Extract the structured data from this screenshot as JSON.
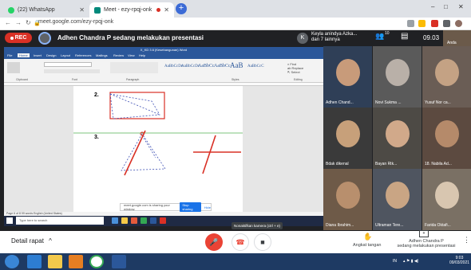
{
  "browser": {
    "tabs": [
      {
        "label": "(22) WhatsApp",
        "active": false
      },
      {
        "label": "Meet - ezy-rpqj-onk",
        "active": true
      }
    ],
    "url": "meet.google.com/ezy-rpqj-onk",
    "new_tab_symbol": "+",
    "controls": [
      "–",
      "□",
      "✕"
    ]
  },
  "meet_top": {
    "rec_label": "REC",
    "presenting_text": "Adhen Chandra P sedang melakukan presentasi",
    "avatar_initial": "K",
    "others_line1": "Keyla anindya Azka...",
    "others_line2": "dan 7 lainnya",
    "participant_count": "10",
    "time": "09.03",
    "self_name": "Anda"
  },
  "word": {
    "title": "X_KD 3.6 (Kesebangunan) Word",
    "ribbon_tabs": [
      "File",
      "Home",
      "Insert",
      "Design",
      "Layout",
      "References",
      "Mailings",
      "Review",
      "View",
      "Help"
    ],
    "styles": [
      "AaBbCcDc",
      "AaBbCcDc",
      "AaBbCc",
      "AaBbCc",
      "AaB",
      "AaBbCcC"
    ],
    "groups": [
      "Clipboard",
      "Font",
      "Paragraph",
      "Styles",
      "Editing"
    ],
    "question_numbers": [
      "2.",
      "3."
    ],
    "status_text": "Page 6 of 8   99 words   English (United States)",
    "taskbar_search": "Type here to search"
  },
  "share_bar": {
    "text": "meet.google.com is sharing your window.",
    "stop_label": "Stop sharing",
    "hide_label": "Hide"
  },
  "tooltip": "Nonaktifkan kamera (ctrl + e)",
  "participants": [
    {
      "name": "Adhen Chand...",
      "bg": "#2f3f57",
      "face": "#c89b7a"
    },
    {
      "name": "Novi Sukma ...",
      "bg": "#5a5a5a",
      "face": "#b9b0a8"
    },
    {
      "name": "Yusuf Nor ca...",
      "bg": "#6a5d55",
      "face": "#c4a284"
    },
    {
      "name": "Bdak dikenal",
      "bg": "#3a3a3a",
      "face": "#c7a07a"
    },
    {
      "name": "Bayan Rtk...",
      "bg": "#4d4a45",
      "face": "#d1a98a"
    },
    {
      "name": "18. Nabila Ad...",
      "bg": "#5c4a40",
      "face": "#b58a6a"
    },
    {
      "name": "Diana Ibrahim...",
      "bg": "#6e5a48",
      "face": "#b88f6d"
    },
    {
      "name": "Ultraman Tere...",
      "bg": "#4f5560",
      "face": "#c9a584"
    },
    {
      "name": "Farida Oktafi...",
      "bg": "#7a7064",
      "face": "#d8c6b0"
    }
  ],
  "bottom": {
    "detail_label": "Detail rapat",
    "raise_label": "Angkat tangan",
    "present_line1": "Adhen Chandra P",
    "present_line2": "sedang melakukan presentasi"
  },
  "windows": {
    "tray_lang": "IN",
    "time": "9:03",
    "date": "09/03/2021"
  },
  "colors": {
    "meet_dark": "#202124",
    "word_blue": "#2b579a",
    "rec_red": "#d93025",
    "mute_red": "#ea4335",
    "annotation_red": "#d93025",
    "dashed_blue": "#3f51b5"
  }
}
